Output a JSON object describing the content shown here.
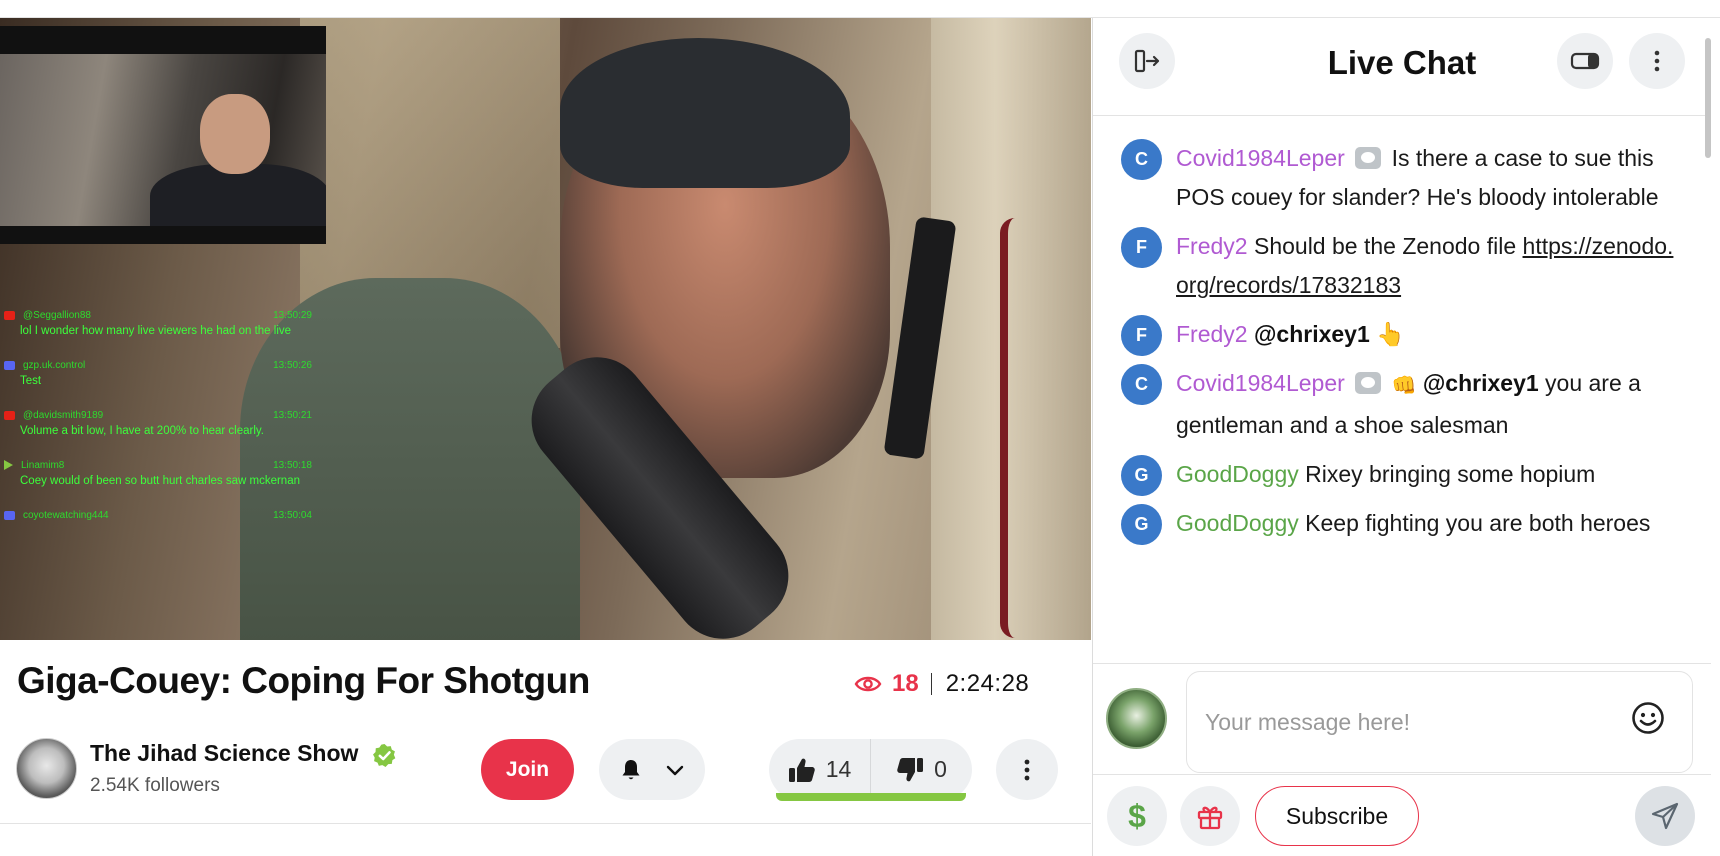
{
  "video": {
    "overlay_chat": [
      {
        "platform": "youtube",
        "user": "@Seggallion88",
        "time": "13:50:29",
        "text": "lol I wonder how many live viewers he had on the live"
      },
      {
        "platform": "discord",
        "user": "gzp.uk.control",
        "time": "13:50:26",
        "text": "Test"
      },
      {
        "platform": "youtube",
        "user": "@davidsmith9189",
        "time": "13:50:21",
        "text": "Volume a bit low, I have at 200% to hear clearly."
      },
      {
        "platform": "rumble",
        "user": "Linamim8",
        "time": "13:50:18",
        "text": "Coey would of been so butt hurt charles saw mckernan"
      },
      {
        "platform": "discord",
        "user": "coyotewatching444",
        "time": "13:50:04",
        "text": ""
      }
    ]
  },
  "stream": {
    "title": "Giga-Couey: Coping For Shotgun",
    "viewers": "18",
    "duration": "2:24:28"
  },
  "channel": {
    "name": "The Jihad Science Show",
    "followers": "2.54K followers",
    "verified_icon": "verified-check-icon",
    "join_label": "Join"
  },
  "votes": {
    "likes": "14",
    "dislikes": "0",
    "like_ratio": 1.0,
    "like_color": "#85c742"
  },
  "chat": {
    "title": "Live Chat",
    "messages": [
      {
        "initial": "C",
        "user": "Covid1984Leper",
        "user_color": "purple",
        "badge": true,
        "extra": "",
        "mention": "",
        "text": "Is there a case to sue this POS couey for slander? He's bloody intolerable",
        "link": ""
      },
      {
        "initial": "F",
        "user": "Fredy2",
        "user_color": "purple",
        "badge": false,
        "extra": "",
        "mention": "",
        "text": "Should be the Zenodo file",
        "link": "https://zenodo.org/records/17832183"
      },
      {
        "initial": "F",
        "user": "Fredy2",
        "user_color": "purple",
        "badge": false,
        "extra": "",
        "mention": "@chrixey1",
        "text": "👆",
        "link": ""
      },
      {
        "initial": "C",
        "user": "Covid1984Leper",
        "user_color": "purple",
        "badge": true,
        "extra": "👊",
        "mention": "@chrixey1",
        "text": "you are a gentleman and a shoe salesman",
        "link": ""
      },
      {
        "initial": "G",
        "user": "GoodDoggy",
        "user_color": "green",
        "badge": false,
        "extra": "",
        "mention": "",
        "text": "Rixey bringing some hopium",
        "link": ""
      },
      {
        "initial": "G",
        "user": "GoodDoggy",
        "user_color": "green",
        "badge": false,
        "extra": "",
        "mention": "",
        "text": "Keep fighting you are both heroes",
        "link": ""
      }
    ],
    "input_placeholder": "Your message here!",
    "tip_symbol": "$",
    "subscribe_label": "Subscribe"
  },
  "colors": {
    "accent": "#e8334a",
    "green": "#85c742",
    "purple_user": "#b05ad2",
    "green_user": "#5aa548",
    "avatar_blue": "#3a79c9"
  }
}
